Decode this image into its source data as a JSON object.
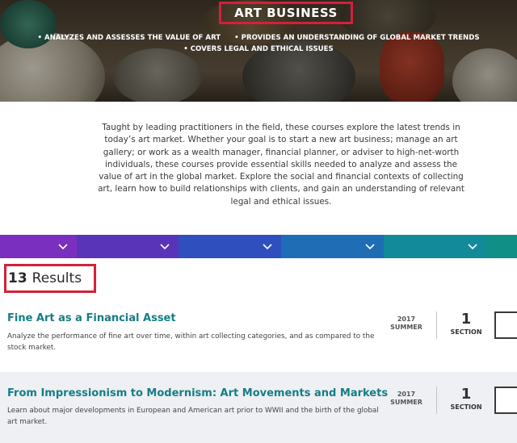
{
  "hero": {
    "title": "ART BUSINESS",
    "bullets_row1": [
      "• ANALYZES AND ASSESSES THE VALUE OF ART",
      "• PROVIDES AN UNDERSTANDING OF GLOBAL MARKET TRENDS"
    ],
    "bullets_row2": [
      "• COVERS LEGAL AND ETHICAL ISSUES"
    ]
  },
  "intro": {
    "text": "Taught by leading practitioners in the field, these courses explore the latest trends in today’s art market. Whether your goal is to start a new art business; manage an art gallery; or work as a wealth manager, financial planner, or adviser to high-net-worth individuals, these courses provide essential skills needed to analyze and assess the value of art in the global market. Explore the social and financial contexts of collecting art, learn how to build relationships with clients, and gain an understanding of relevant legal and ethical issues."
  },
  "filter_bar": {
    "segments": [
      {
        "color": "#7b2fbe",
        "icon": "chevron-down-icon"
      },
      {
        "color": "#5a34b8",
        "icon": "chevron-down-icon"
      },
      {
        "color": "#2f4fbf",
        "icon": "chevron-down-icon"
      },
      {
        "color": "#1f6db5",
        "icon": "chevron-down-icon"
      },
      {
        "color": "#138a9a",
        "icon": "chevron-down-icon"
      },
      {
        "color": "#0f8f86",
        "icon": null
      }
    ]
  },
  "results": {
    "count": "13",
    "label": "Results"
  },
  "courses": [
    {
      "title": "Fine Art as a Financial Asset",
      "description": "Analyze the performance of fine art over time, within art collecting categories, and as compared to the stock market.",
      "year": "2017",
      "term": "SUMMER",
      "section_count": "1",
      "section_label": "SECTION"
    },
    {
      "title": "From Impressionism to Modernism: Art Movements and Markets",
      "description": "Learn about major developments in European and American art prior to WWII and the birth of the global art market.",
      "year": "2017",
      "term": "SUMMER",
      "section_count": "1",
      "section_label": "SECTION"
    }
  ],
  "colors": {
    "accent_teal": "#167d86",
    "highlight_red": "#d4203a"
  }
}
